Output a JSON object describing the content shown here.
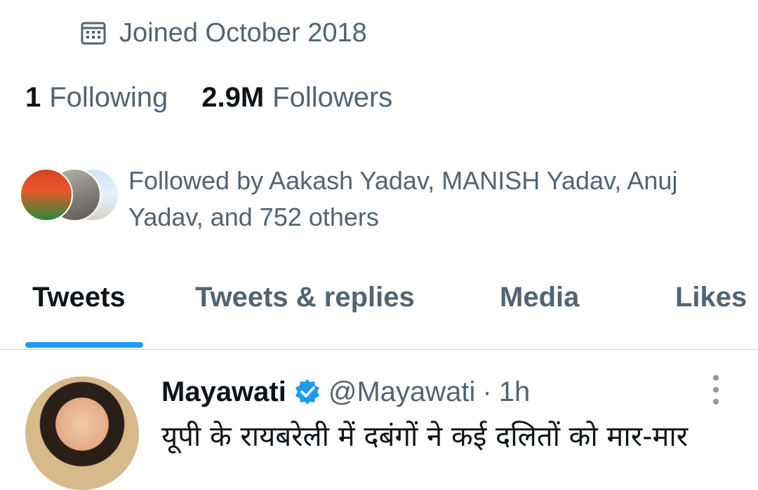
{
  "profile": {
    "joined_text": "Joined October 2018",
    "joined_icon": "calendar-icon",
    "following_count": "1",
    "following_label": "Following",
    "followers_count": "2.9M",
    "followers_label": "Followers",
    "followed_by_text": "Followed by Aakash Yadav, MANISH Yadav, Anuj Yadav, and 752 others"
  },
  "tabs": [
    {
      "label": "Tweets",
      "active": true
    },
    {
      "label": "Tweets & replies",
      "active": false
    },
    {
      "label": "Media",
      "active": false
    },
    {
      "label": "Likes",
      "active": false
    }
  ],
  "tweet": {
    "name": "Mayawati",
    "handle": "@Mayawati",
    "separator": "·",
    "time": "1h",
    "text": "यूपी के रायबरेली में दबंगों ने कई दलितों को मार-मार",
    "verified_icon": "verified-badge-icon",
    "more_icon": "more-options-icon"
  },
  "colors": {
    "accent": "#1d9bf0",
    "secondary_text": "#536471",
    "primary_text": "#0f1419",
    "divider": "#cfd9de"
  }
}
